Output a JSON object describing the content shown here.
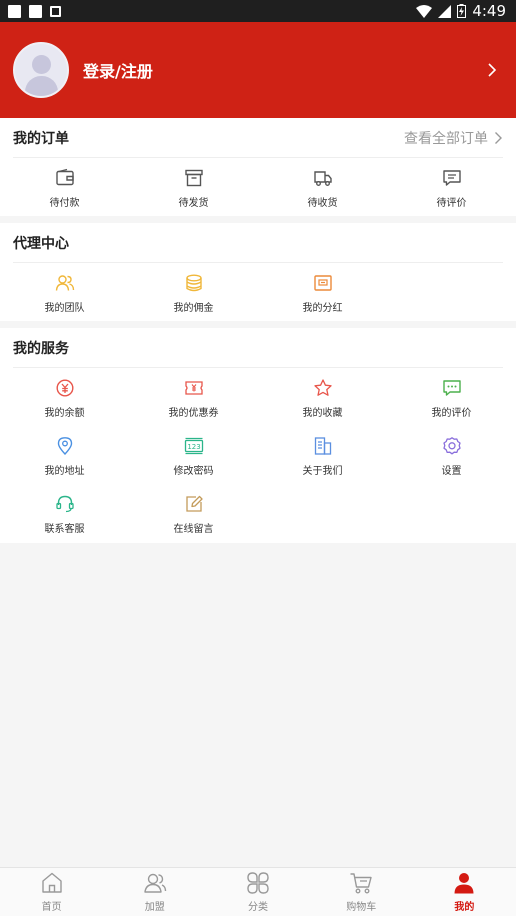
{
  "status_bar": {
    "time": "4:49"
  },
  "profile": {
    "login_label": "登录/注册"
  },
  "orders": {
    "title": "我的订单",
    "view_all": "查看全部订单",
    "items": [
      {
        "label": "待付款",
        "icon": "wallet-icon"
      },
      {
        "label": "待发货",
        "icon": "package-icon"
      },
      {
        "label": "待收货",
        "icon": "truck-icon"
      },
      {
        "label": "待评价",
        "icon": "comment-icon"
      }
    ]
  },
  "agent": {
    "title": "代理中心",
    "items": [
      {
        "label": "我的团队",
        "icon": "team-icon"
      },
      {
        "label": "我的佣金",
        "icon": "coins-icon"
      },
      {
        "label": "我的分红",
        "icon": "dividend-icon"
      }
    ]
  },
  "services": {
    "title": "我的服务",
    "items": [
      {
        "label": "我的余额",
        "icon": "balance-icon"
      },
      {
        "label": "我的优惠券",
        "icon": "coupon-icon"
      },
      {
        "label": "我的收藏",
        "icon": "star-icon"
      },
      {
        "label": "我的评价",
        "icon": "review-icon"
      },
      {
        "label": "我的地址",
        "icon": "location-icon"
      },
      {
        "label": "修改密码",
        "icon": "password-icon"
      },
      {
        "label": "关于我们",
        "icon": "about-icon"
      },
      {
        "label": "设置",
        "icon": "gear-icon"
      },
      {
        "label": "联系客服",
        "icon": "headset-icon"
      },
      {
        "label": "在线留言",
        "icon": "edit-icon"
      }
    ]
  },
  "tabbar": {
    "items": [
      {
        "label": "首页",
        "icon": "home-icon"
      },
      {
        "label": "加盟",
        "icon": "join-icon"
      },
      {
        "label": "分类",
        "icon": "category-icon"
      },
      {
        "label": "购物车",
        "icon": "cart-icon"
      },
      {
        "label": "我的",
        "icon": "user-icon",
        "active": true
      }
    ]
  },
  "colors": {
    "brand_red": "#cf2215",
    "tab_active": "#d41a12",
    "order_icon": "#555555",
    "agent_icon": "#f0b73a",
    "balance_icon": "#e8564b",
    "review_icon": "#4cb04d",
    "location_icon": "#4a90e2",
    "password_icon": "#2bb58a",
    "about_icon": "#5b8fe0",
    "gear_icon": "#8a6fdc",
    "headset_icon": "#2bb58a",
    "edit_icon": "#c39b5a"
  }
}
